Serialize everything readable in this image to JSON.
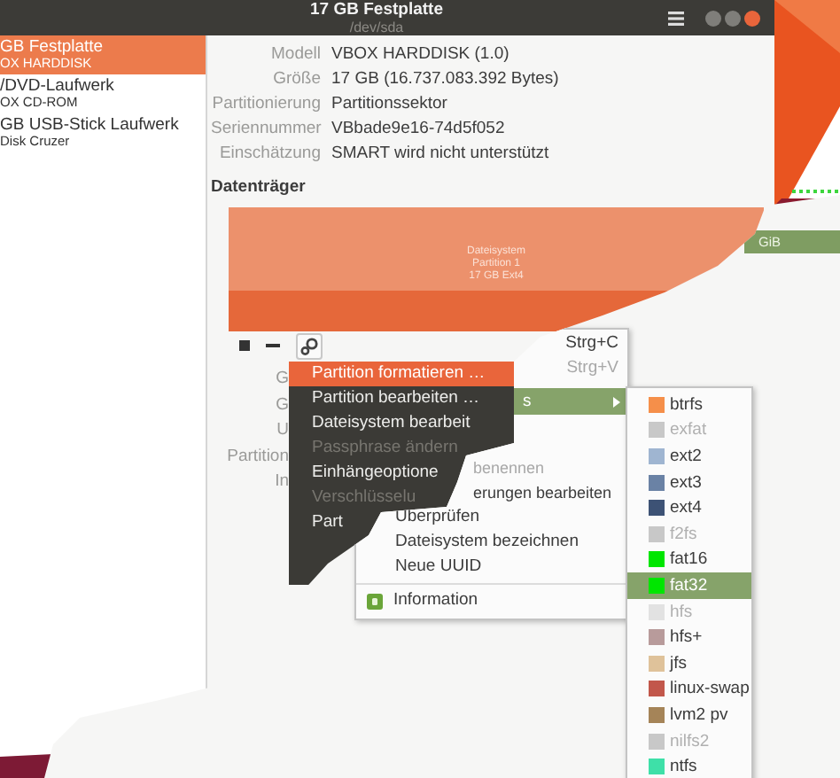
{
  "window": {
    "title": "17 GB Festplatte",
    "subtitle": "/dev/sda"
  },
  "sidebar": {
    "items": [
      {
        "name": "GB Festplatte",
        "detail": "OX HARDDISK",
        "selected": true
      },
      {
        "name": "/DVD-Laufwerk",
        "detail": "OX CD-ROM",
        "selected": false
      },
      {
        "name": "GB USB-Stick Laufwerk",
        "detail": "Disk Cruzer",
        "selected": false
      }
    ]
  },
  "properties": [
    {
      "label": "Modell",
      "value": "VBOX HARDDISK (1.0)"
    },
    {
      "label": "Größe",
      "value": "17 GB (16.737.083.392 Bytes)"
    },
    {
      "label": "Partitionierung",
      "value": "Partitionssektor"
    },
    {
      "label": "Seriennummer",
      "value": "VBbade9e16-74d5f052"
    },
    {
      "label": "Einschätzung",
      "value": "SMART wird nicht unterstützt"
    }
  ],
  "volumes": {
    "heading": "Datenträger",
    "partition_lines": [
      "Dateisystem",
      "Partition 1",
      "17 GB Ext4"
    ]
  },
  "partition_labels": [
    "G",
    "G",
    "U",
    "Partition",
    "In"
  ],
  "partition_menu": {
    "items": [
      {
        "label": "Partition formatieren …",
        "selected": true,
        "disabled": false
      },
      {
        "label": "Partition bearbeiten …",
        "selected": false,
        "disabled": false
      },
      {
        "label": "Dateisystem bearbeit",
        "selected": false,
        "disabled": false
      },
      {
        "label": "Passphrase ändern",
        "selected": false,
        "disabled": true
      },
      {
        "label": "Einhängeoptione",
        "selected": false,
        "disabled": false
      },
      {
        "label": "Verschlüsselu",
        "selected": false,
        "disabled": true
      },
      {
        "label": "Part",
        "selected": false,
        "disabled": false
      }
    ]
  },
  "overlay": {
    "bar_label": "GiB",
    "menu": {
      "items": [
        {
          "kind": "shortcut",
          "shortcut": "Strg+C",
          "disabled": false
        },
        {
          "kind": "shortcut",
          "shortcut": "Strg+V",
          "disabled": true
        },
        {
          "kind": "submenu",
          "label": "s",
          "selected": true,
          "disabled": false
        },
        {
          "kind": "cut",
          "label": "benennen",
          "selected": false,
          "disabled": true
        },
        {
          "kind": "cut",
          "label": "erungen bearbeiten",
          "selected": false,
          "disabled": false
        },
        {
          "kind": "item",
          "label": "Überprüfen",
          "selected": false,
          "disabled": false
        },
        {
          "kind": "item",
          "label": "Dateisystem bezeichnen",
          "selected": false,
          "disabled": false
        },
        {
          "kind": "item",
          "label": "Neue UUID",
          "selected": false,
          "disabled": false
        },
        {
          "kind": "separator"
        },
        {
          "kind": "info",
          "label": "Information",
          "selected": false,
          "disabled": false
        }
      ]
    },
    "filesystem_menu": {
      "items": [
        {
          "label": "btrfs",
          "color": "#f58f4a",
          "disabled": false,
          "selected": false
        },
        {
          "label": "exfat",
          "color": "#c8c8c8",
          "disabled": true,
          "selected": false
        },
        {
          "label": "ext2",
          "color": "#9fb5d1",
          "disabled": false,
          "selected": false
        },
        {
          "label": "ext3",
          "color": "#6a82a5",
          "disabled": false,
          "selected": false
        },
        {
          "label": "ext4",
          "color": "#3d5275",
          "disabled": false,
          "selected": false
        },
        {
          "label": "f2fs",
          "color": "#c8c8c8",
          "disabled": true,
          "selected": false
        },
        {
          "label": "fat16",
          "color": "#00e600",
          "disabled": false,
          "selected": false
        },
        {
          "label": "fat32",
          "color": "#00e600",
          "disabled": false,
          "selected": true
        },
        {
          "label": "hfs",
          "color": "#e2e2e2",
          "disabled": true,
          "selected": false
        },
        {
          "label": "hfs+",
          "color": "#b89b9b",
          "disabled": false,
          "selected": false
        },
        {
          "label": "jfs",
          "color": "#dfc29a",
          "disabled": false,
          "selected": false
        },
        {
          "label": "linux-swap",
          "color": "#c2574b",
          "disabled": false,
          "selected": false
        },
        {
          "label": "lvm2 pv",
          "color": "#a58458",
          "disabled": false,
          "selected": false
        },
        {
          "label": "nilfs2",
          "color": "#c8c8c8",
          "disabled": true,
          "selected": false
        },
        {
          "label": "ntfs",
          "color": "#3ee0a8",
          "disabled": false,
          "selected": false
        }
      ]
    }
  }
}
